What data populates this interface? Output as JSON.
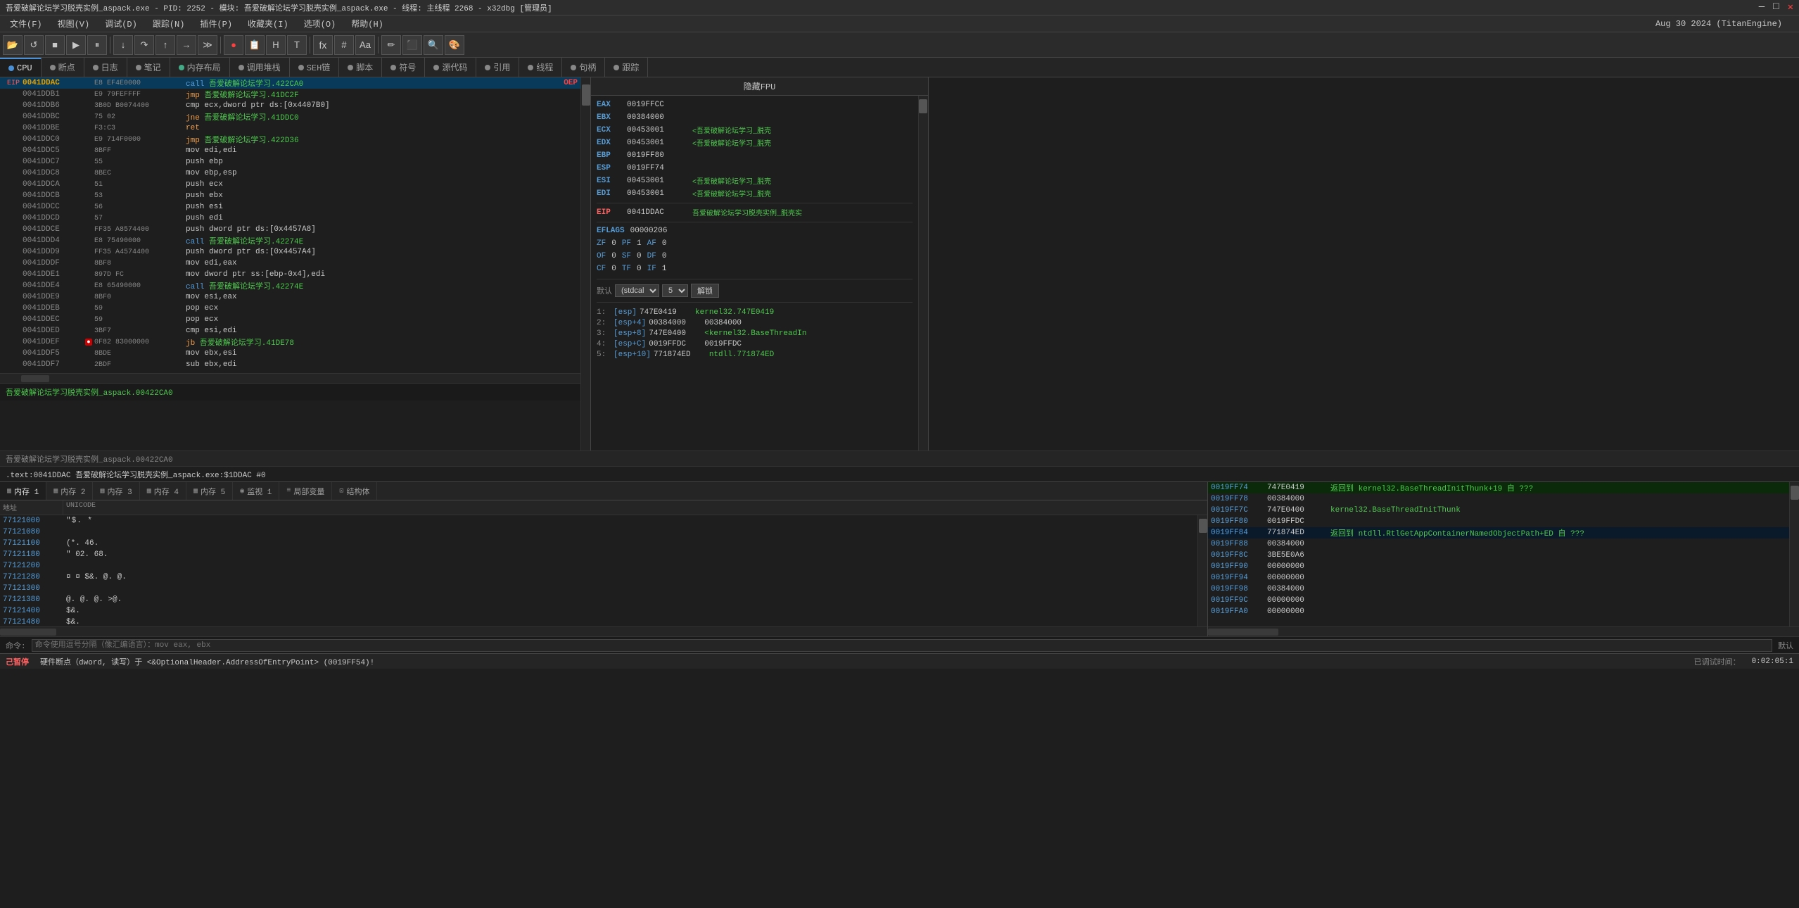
{
  "titlebar": {
    "title": "吾爱破解论坛学习脱壳实例_aspack.exe - PID: 2252 - 模块: 吾爱破解论坛学习脱壳实例_aspack.exe - 线程: 主线程 2268 - x32dbg [管理员]",
    "controls": [
      "—",
      "□",
      "✕"
    ]
  },
  "menubar": {
    "items": [
      "文件(F)",
      "视图(V)",
      "调试(D)",
      "跟踪(N)",
      "插件(P)",
      "收藏夹(I)",
      "选项(O)",
      "帮助(H)"
    ],
    "date": "Aug 30 2024  (TitanEngine)"
  },
  "tabs": [
    {
      "label": "CPU",
      "dot_color": "#888",
      "active": true
    },
    {
      "label": "断点",
      "dot_color": "#888",
      "active": false
    },
    {
      "label": "日志",
      "dot_color": "#888",
      "active": false
    },
    {
      "label": "笔记",
      "dot_color": "#888",
      "active": false
    },
    {
      "label": "内存布局",
      "dot_color": "#4a8",
      "active": false
    },
    {
      "label": "调用堆栈",
      "dot_color": "#888",
      "active": false
    },
    {
      "label": "SEH链",
      "dot_color": "#888",
      "active": false
    },
    {
      "label": "脚本",
      "dot_color": "#888",
      "active": false
    },
    {
      "label": "符号",
      "dot_color": "#888",
      "active": false
    },
    {
      "label": "源代码",
      "dot_color": "#888",
      "active": false
    },
    {
      "label": "引用",
      "dot_color": "#888",
      "active": false
    },
    {
      "label": "线程",
      "dot_color": "#888",
      "active": false
    },
    {
      "label": "句柄",
      "dot_color": "#888",
      "active": false
    },
    {
      "label": "跟踪",
      "dot_color": "#888",
      "active": false
    }
  ],
  "registers": {
    "title": "隐藏FPU",
    "regs": [
      {
        "name": "EAX",
        "val": "0019FFCC",
        "desc": ""
      },
      {
        "name": "EBX",
        "val": "00384000",
        "desc": ""
      },
      {
        "name": "ECX",
        "val": "00453001",
        "desc": "<吾爱破解论坛学习_脱壳"
      },
      {
        "name": "EDX",
        "val": "00453001",
        "desc": "<吾爱破解论坛学习_脱壳"
      },
      {
        "name": "EBP",
        "val": "0019FF80",
        "desc": ""
      },
      {
        "name": "ESP",
        "val": "0019FF74",
        "desc": ""
      },
      {
        "name": "ESI",
        "val": "00453001",
        "desc": "<吾爱破解论坛学习_脱壳"
      },
      {
        "name": "EDI",
        "val": "00453001",
        "desc": "<吾爱破解论坛学习_脱壳"
      },
      {
        "name": "EIP",
        "val": "0041DDAC",
        "desc": "吾爱破解论坛学习脱壳实例_脱壳实"
      }
    ],
    "eflags": {
      "label": "EFLAGS",
      "val": "00000206",
      "flags": [
        {
          "name": "ZF",
          "val": "0"
        },
        {
          "name": "PF",
          "val": "1"
        },
        {
          "name": "AF",
          "val": "0"
        },
        {
          "name": "OF",
          "val": "0"
        },
        {
          "name": "SF",
          "val": "0"
        },
        {
          "name": "DF",
          "val": "0"
        },
        {
          "name": "CF",
          "val": "0"
        },
        {
          "name": "TF",
          "val": "0"
        },
        {
          "name": "IF",
          "val": "1"
        }
      ]
    },
    "calling_conv": {
      "label": "默认 (stdcal",
      "num": "5",
      "unlock_label": "解锁"
    },
    "stack_items": [
      {
        "idx": "1:",
        "ref": "[esp]",
        "val": "747E0419",
        "comment": "kernel32.747E0419"
      },
      {
        "idx": "2:",
        "ref": "[esp+4]",
        "val": "00384000",
        "comment": "00384000"
      },
      {
        "idx": "3:",
        "ref": "[esp+8]",
        "val": "747E0400",
        "comment": "<kernel32.BaseThreadIn"
      },
      {
        "idx": "4:",
        "ref": "[esp+C]",
        "val": "0019FFDC",
        "comment": "0019FFDC"
      },
      {
        "idx": "5:",
        "ref": "[esp+10]",
        "val": "771874ED",
        "comment": "ntdll.771874ED"
      }
    ]
  },
  "disassembly": {
    "eip_label": "EIP",
    "rows": [
      {
        "addr": "0041DDAC",
        "is_eip": true,
        "bytes": "E8 EF4E0000",
        "instr": "call",
        "operand": "吾爱破解论坛学习.422CA0",
        "comment": "OEP",
        "is_active": true
      },
      {
        "addr": "0041DDB1",
        "is_eip": false,
        "bytes": "E9 79FEFFFF",
        "instr": "jmp",
        "operand": "吾爱破解论坛学习.41DC2F"
      },
      {
        "addr": "0041DDB6",
        "is_eip": false,
        "bytes": "3B0D B0074400",
        "instr": "cmp",
        "operand": "ecx,dword ptr ds:[0x4407B0]"
      },
      {
        "addr": "0041DDBC",
        "is_eip": false,
        "bytes": "75 02",
        "instr": "jne",
        "operand": "吾爱破解论坛学习.41DDC0"
      },
      {
        "addr": "0041DDBE",
        "is_eip": false,
        "bytes": "F3:C3",
        "instr": "ret",
        "operand": ""
      },
      {
        "addr": "0041DDC0",
        "is_eip": false,
        "bytes": "E9 714F0000",
        "instr": "jmp",
        "operand": "吾爱破解论坛学习.422D36"
      },
      {
        "addr": "0041DDC5",
        "is_eip": false,
        "bytes": "8BFF",
        "instr": "mov",
        "operand": "edi,edi"
      },
      {
        "addr": "0041DDC7",
        "is_eip": false,
        "bytes": "55",
        "instr": "push",
        "operand": "ebp"
      },
      {
        "addr": "0041DDC8",
        "is_eip": false,
        "bytes": "8BEC",
        "instr": "mov",
        "operand": "ebp,esp"
      },
      {
        "addr": "0041DDCA",
        "is_eip": false,
        "bytes": "51",
        "instr": "push",
        "operand": "ecx"
      },
      {
        "addr": "0041DDCB",
        "is_eip": false,
        "bytes": "53",
        "instr": "push",
        "operand": "ebx"
      },
      {
        "addr": "0041DDCC",
        "is_eip": false,
        "bytes": "56",
        "instr": "push",
        "operand": "esi"
      },
      {
        "addr": "0041DDCD",
        "is_eip": false,
        "bytes": "57",
        "instr": "push",
        "operand": "edi"
      },
      {
        "addr": "0041DDCE",
        "is_eip": false,
        "bytes": "FF35 A8574400",
        "instr": "push",
        "operand": "dword ptr ds:[0x4457A8]"
      },
      {
        "addr": "0041DDD4",
        "is_eip": false,
        "bytes": "E8 75490000",
        "instr": "call",
        "operand": "吾爱破解论坛学习.42274E"
      },
      {
        "addr": "0041DDD9",
        "is_eip": false,
        "bytes": "FF35 A4574400",
        "instr": "push",
        "operand": "dword ptr ds:[0x4457A4]"
      },
      {
        "addr": "0041DDDF",
        "is_eip": false,
        "bytes": "8BF8",
        "instr": "mov",
        "operand": "edi,eax"
      },
      {
        "addr": "0041DDE1",
        "is_eip": false,
        "bytes": "897D FC",
        "instr": "mov",
        "operand": "dword ptr ss:[ebp-0x4],edi"
      },
      {
        "addr": "0041DDE4",
        "is_eip": false,
        "bytes": "E8 65490000",
        "instr": "call",
        "operand": "吾爱破解论坛学习.42274E"
      },
      {
        "addr": "0041DDE9",
        "is_eip": false,
        "bytes": "8BF0",
        "instr": "mov",
        "operand": "esi,eax"
      },
      {
        "addr": "0041DDEB",
        "is_eip": false,
        "bytes": "59",
        "instr": "pop",
        "operand": "ecx"
      },
      {
        "addr": "0041DDEC",
        "is_eip": false,
        "bytes": "59",
        "instr": "pop",
        "operand": "ecx"
      },
      {
        "addr": "0041DDED",
        "is_eip": false,
        "bytes": "3BF7",
        "instr": "cmp",
        "operand": "esi,edi"
      },
      {
        "addr": "0041DDEF",
        "is_eip": false,
        "bytes": "0F82 83000000",
        "instr": "jb",
        "operand": "吾爱破解论坛学习.41DE78",
        "has_bp": true
      },
      {
        "addr": "0041DDF5",
        "is_eip": false,
        "bytes": "8BDE",
        "instr": "mov",
        "operand": "ebx,esi"
      },
      {
        "addr": "0041DDF7",
        "is_eip": false,
        "bytes": "2BDF",
        "instr": "sub",
        "operand": "ebx,edi"
      }
    ]
  },
  "bottom_label": "吾爱破解论坛学习脱壳实例_aspack.00422CA0",
  "status_line": ".text:0041DDAC  吾爱破解论坛学习脱壳实例_aspack.exe:$1DDAC  #0",
  "memory_tabs": [
    {
      "label": "内存 1",
      "active": true
    },
    {
      "label": "内存 2",
      "active": false
    },
    {
      "label": "内存 3",
      "active": false
    },
    {
      "label": "内存 4",
      "active": false
    },
    {
      "label": "内存 5",
      "active": false
    },
    {
      "label": "监视 1",
      "active": false
    },
    {
      "label": "局部变量",
      "active": false
    },
    {
      "label": "结构体",
      "active": false
    }
  ],
  "memory_cols": [
    "地址",
    "UNICODE"
  ],
  "memory_rows": [
    {
      "addr": "77121000",
      "data": "                         \"$. *                                                       "
    },
    {
      "addr": "77121080",
      "data": "                                                                                       "
    },
    {
      "addr": "77121100",
      "data": "                         (*. 46.                                                       "
    },
    {
      "addr": "77121180",
      "data": "     \" 02.          68.                                                                "
    },
    {
      "addr": "77121200",
      "data": "                                                                                       "
    },
    {
      "addr": "77121280",
      "data": "   ¤              ¤  $&.         @.           @.                                       "
    },
    {
      "addr": "77121300",
      "data": "                                                                                       "
    },
    {
      "addr": "77121380",
      "data": "    @.        @.    @.     >@.                                                         "
    },
    {
      "addr": "77121400",
      "data": "   $&.                                                                                 "
    }
  ],
  "right_stack": {
    "rows": [
      {
        "addr": "0019FF74",
        "val": "747E0419",
        "comment": "返回到 kernel32.BaseThreadInitThunk+19 自 ???"
      },
      {
        "addr": "0019FF78",
        "val": "00384000",
        "comment": ""
      },
      {
        "addr": "0019FF7C",
        "val": "747E0400",
        "comment": "kernel32.BaseThreadInitThunk"
      },
      {
        "addr": "0019FF80",
        "val": "0019FFDC",
        "comment": ""
      },
      {
        "addr": "0019FF84",
        "val": "771874ED",
        "comment": "返回到 ntdll.RtlGetAppContainerNamedObjectPath+ED 自 ???"
      },
      {
        "addr": "0019FF88",
        "val": "00384000",
        "comment": ""
      },
      {
        "addr": "0019FF8C",
        "val": "3BE5E0A6",
        "comment": ""
      },
      {
        "addr": "0019FF90",
        "val": "00000000",
        "comment": ""
      },
      {
        "addr": "0019FF94",
        "val": "00000000",
        "comment": ""
      },
      {
        "addr": "0019FF98",
        "val": "00384000",
        "comment": ""
      },
      {
        "addr": "0019FF9C",
        "val": "00000000",
        "comment": ""
      },
      {
        "addr": "0019FFA0",
        "val": "00000000",
        "comment": ""
      }
    ]
  },
  "cmd_bar": {
    "label": "命令:",
    "placeholder": "命令使用逗号分隔（像汇编语言）：mov eax, ebx"
  },
  "bottom_bar": {
    "debug_label": "己暂停",
    "bp_info": "硬件断点（dword, 读写）于 <&OptionalHeader.AddressOfEntryPoint> (0019FF54)!",
    "time_label": "已调试时间：",
    "time_val": "0:02:05:1"
  }
}
